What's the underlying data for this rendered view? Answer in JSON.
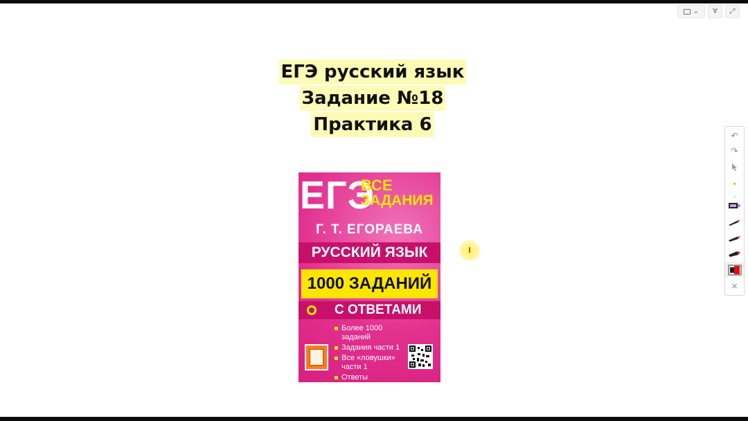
{
  "title": {
    "lines": [
      "ЕГЭ русский язык",
      "Задание №18",
      "Практика 6"
    ]
  },
  "book": {
    "brand": "ЕГЭ",
    "series_line1": "ВСЕ",
    "series_line2": "ЗАДАНИЯ",
    "author": "Г. Т. ЕГОРАЕВА",
    "subject": "РУССКИЙ ЯЗЫК",
    "count": "1000 ЗАДАНИЙ",
    "answers": "С ОТВЕТАМИ",
    "features": [
      "Более 1000 заданий",
      "Задания части 1",
      "Все «ловушки» части 1",
      "Ответы"
    ],
    "colors": {
      "cover": "#e2318f",
      "accent": "#ffe600",
      "band": "#c8106b"
    }
  },
  "toolbar": {
    "undo_icon": "↶",
    "redo_icon": "↷",
    "close_icon": "×"
  },
  "view_controls": {
    "chevron": "⌄",
    "filter": "∀",
    "expand": "⤢"
  }
}
